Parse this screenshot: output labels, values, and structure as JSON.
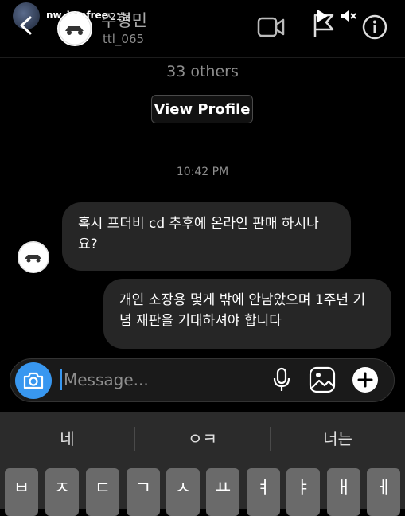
{
  "story": {
    "username": "nw_iamfree",
    "time": "21분"
  },
  "chat": {
    "name": "주형민",
    "handle": "ttl_065"
  },
  "profile": {
    "others": "33 others",
    "view_profile_label": "View Profile"
  },
  "timestamp": "10:42 PM",
  "messages": [
    {
      "text": "혹시 프더비 cd 추후에 온라인 판매 하시나요?",
      "side": "received"
    },
    {
      "text": "개인 소장용 몇게 밖에 안남았으며 1주년 기념 재판을 기대하셔야 합니다",
      "side": "sent"
    }
  ],
  "composer": {
    "placeholder": "Message..."
  },
  "keyboard": {
    "suggestions": [
      "네",
      "ㅇㅋ",
      "너는"
    ],
    "keys": [
      "ㅂ",
      "ㅈ",
      "ㄷ",
      "ㄱ",
      "ㅅ",
      "ㅛ",
      "ㅕ",
      "ㅑ",
      "ㅐ",
      "ㅔ"
    ]
  },
  "colors": {
    "accent": "#3897f0",
    "bubble": "#262626",
    "background": "#000000"
  },
  "icons": [
    "back-icon",
    "video-icon",
    "flag-icon",
    "play-icon",
    "mute-icon",
    "info-icon",
    "camera-icon",
    "mic-icon",
    "gallery-icon",
    "add-icon"
  ]
}
